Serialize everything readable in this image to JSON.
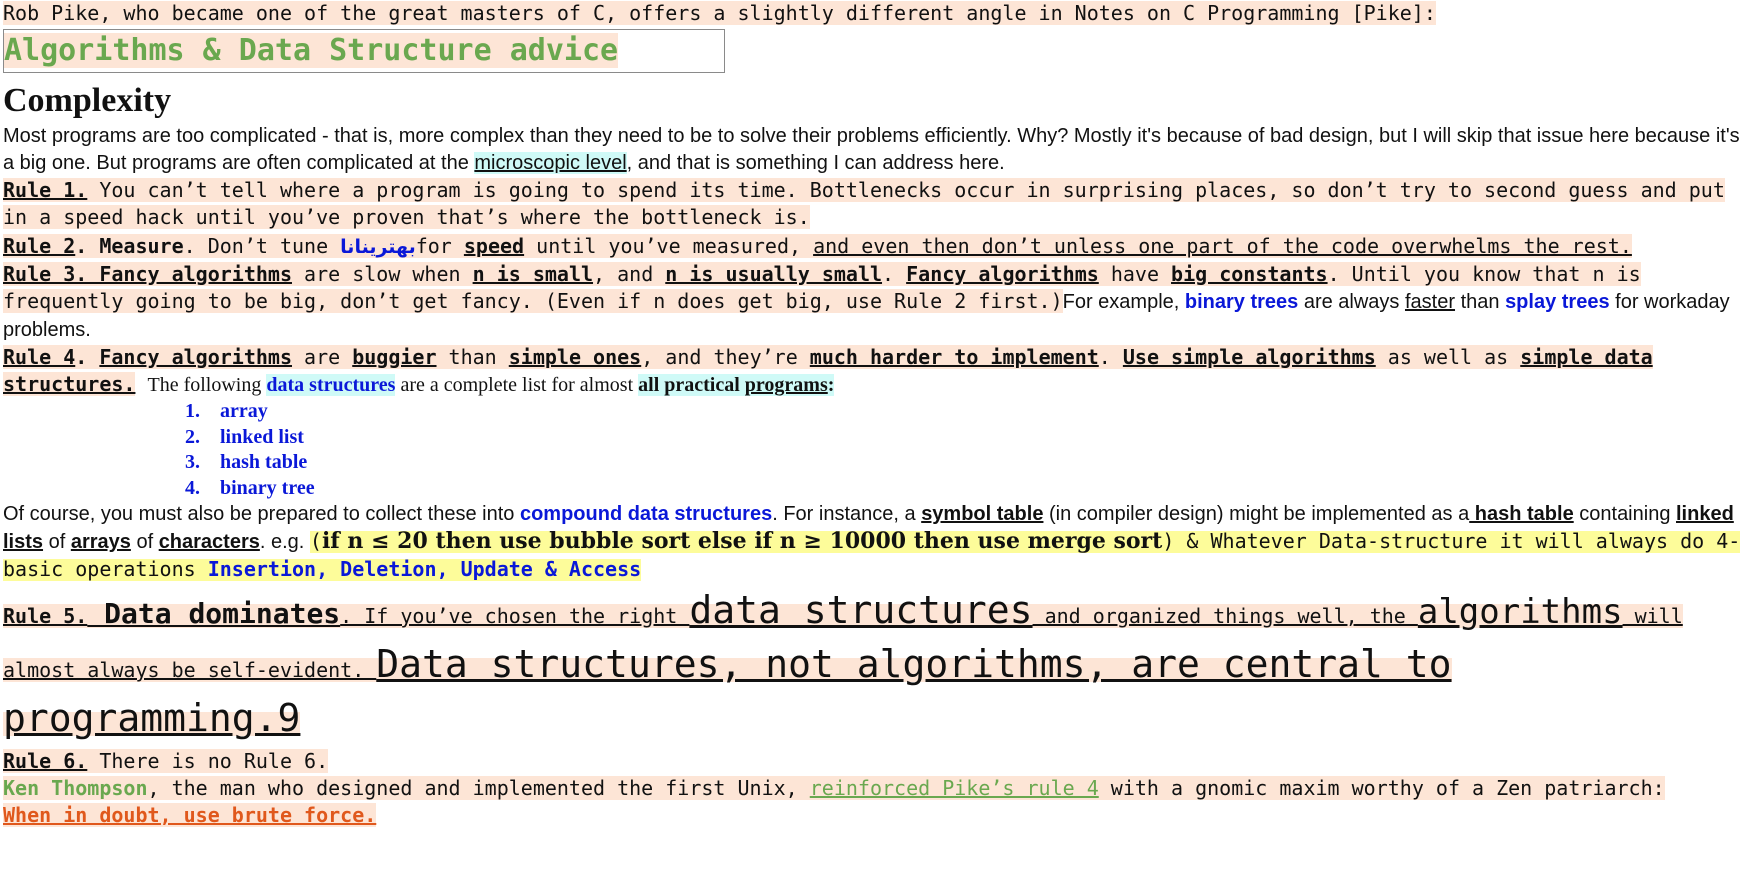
{
  "intro": {
    "text": "Rob Pike, who became one of the great masters of C, offers a slightly different angle in Notes on C Programming [Pike]:"
  },
  "title": "Algorithms & Data Structure advice",
  "complexity": {
    "heading": "Complexity",
    "p1": " Most programs are too complicated - that is, more complex than they need to be to solve their problems efficiently.  Why? Mostly it's because of bad design, but I will skip that issue here because it's a big one.  But programs are often complicated at the ",
    "link": "microscopic level",
    "p2": ", and that is something I can address here."
  },
  "rule1": {
    "label": "Rule 1.",
    "text": " You can’t tell where a program is going to spend its time. Bottlenecks occur in surprising places, so don’t try to second guess and put in a speed hack until you’ve proven that’s where the bottleneck is."
  },
  "rule2": {
    "label": "Rule 2",
    "dot": ".",
    "measure": " Measure",
    "t1": ". Don’t tune ",
    "arabic": "بهترينانا",
    "t2": "for ",
    "speed": "speed",
    "t3": " until you’ve measured, ",
    "tail": "and even then don’t unless one part of the code overwhelms the rest."
  },
  "rule3": {
    "label": "Rule 3. Fancy algorithms",
    "t1": " are slow when ",
    "s1": "n is small",
    "t2": ", and ",
    "s2": "n is usually small",
    "t3": ". ",
    "s3": "Fancy algorithms",
    "t4": " have ",
    "s4": "big constants",
    "t5": ". Until you know that n is frequently going to be big, don’t get fancy. (Even if n does get big, use Rule 2 first.)",
    "sans1": "For example, ",
    "bt": "binary trees",
    "sans2": " are always ",
    "faster": "faster",
    "sans3": " than ",
    "st": "splay trees",
    "sans4": " for workaday problems."
  },
  "rule4": {
    "label": "Rule 4",
    "t0": ". ",
    "s1": "Fancy algorithms",
    "t1": " are ",
    "s2": "buggier",
    "t2": " than ",
    "s3": "simple ones",
    "t3": ", and they’re ",
    "s4": "much harder to implement",
    "t4": ". ",
    "s5": "Use simple algorithms",
    "t5": " as well as ",
    "s6": "simple data structures.",
    "serif1": "The following ",
    "ds": "data structures",
    "serif2": " are a complete list for almost ",
    "ap1": "all practical ",
    "ap2": "programs",
    "colon": ":"
  },
  "list": [
    "array",
    "linked list",
    "hash table",
    "binary tree"
  ],
  "compound": {
    "t1": "Of course, you must also be prepared to collect these into ",
    "cds": "compound data structures",
    "t2": ".  For instance, a ",
    "sym": "symbol table",
    "t3": " (in compiler design) might be implemented as a",
    "ht": " hash table",
    "t4": " containing ",
    "ll": "linked lists",
    "t5": " of ",
    "arr": "arrays",
    "t6": " of ",
    "ch": "characters",
    "t7": ". e.g. ",
    "paren_open": "(",
    "math": "if n ≤  20 then use bubble sort else if n  ≥  10000 then use merge sort",
    "mono1": ") & Whatever Data-structure it will always do 4-basic operations ",
    "ops": "Insertion, Deletion,  Update & Access"
  },
  "rule5": {
    "label": "Rule 5.",
    "dd": " Data dominates",
    "t1": ". If you’ve chosen the right ",
    "ds": "data structures",
    "t2": " and organized things well, the ",
    "alg": "algorithms",
    "t3": " will almost always be self-evident. ",
    "big": "Data structures, not algorithms, are central to programming.9"
  },
  "rule6": {
    "label": "Rule 6.",
    "text": " There is no Rule 6."
  },
  "thompson": {
    "name": "Ken Thompson",
    "t1": ", the man who designed and implemented the first Unix, ",
    "link": "reinforced Pike’s rule 4",
    "t2": " with a gnomic maxim worthy of a Zen patriarch:"
  },
  "maxim": "When in doubt, use brute force."
}
